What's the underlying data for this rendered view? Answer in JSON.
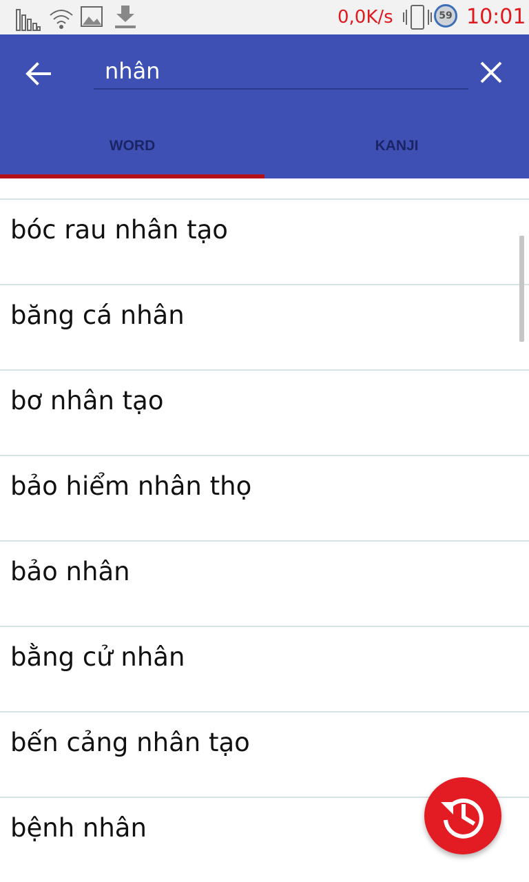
{
  "status_bar": {
    "network_speed": "0,0K/s",
    "badge": "59",
    "clock": "10:01",
    "icons": [
      "signal-bars-icon",
      "wifi-icon",
      "image-icon",
      "download-icon",
      "vibrate-icon"
    ],
    "accent_color": "#e0191e"
  },
  "app_bar": {
    "back_icon": "arrow-left-icon",
    "search_value": "nhân",
    "clear_icon": "close-icon",
    "background_color": "#3e50b4"
  },
  "tabs": [
    {
      "label": "WORD",
      "selected": true
    },
    {
      "label": "KANJI",
      "selected": false
    }
  ],
  "results": [
    "bóc rau nhân tạo",
    "băng cá nhân",
    "bơ nhân tạo",
    "bảo hiểm nhân thọ",
    "bảo nhân",
    "bằng cử nhân",
    "bến cảng nhân tạo",
    "bệnh nhân"
  ],
  "fab": {
    "icon": "history-icon",
    "color": "#e31b23"
  }
}
